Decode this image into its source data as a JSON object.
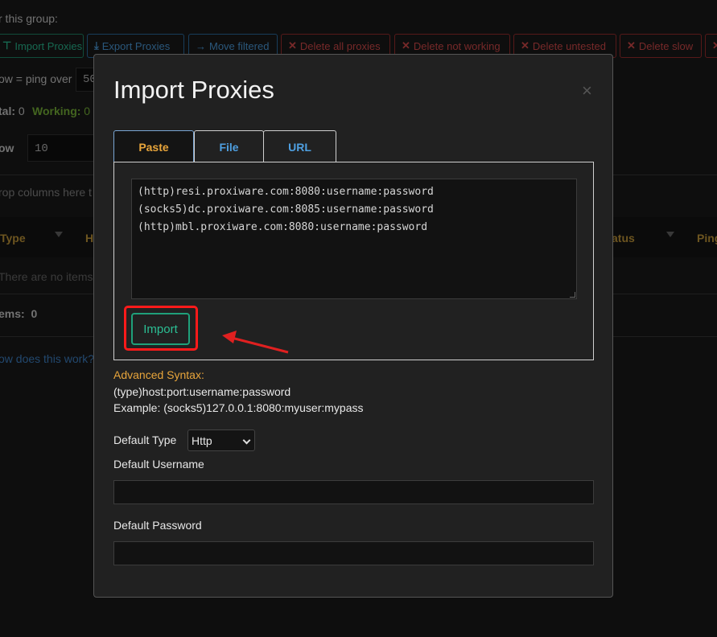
{
  "background": {
    "group_label": "r this group:",
    "toolbar": [
      {
        "label": "Import Proxies",
        "icon": "filter-icon",
        "style": "green"
      },
      {
        "label": "Export Proxies",
        "icon": "download-icon",
        "style": "blue"
      },
      {
        "label": "Move filtered",
        "icon": "arrow-right-icon",
        "style": "blue"
      },
      {
        "label": "Delete all proxies",
        "icon": "x-icon",
        "style": "red"
      },
      {
        "label": "Delete not working",
        "icon": "x-icon",
        "style": "red"
      },
      {
        "label": "Delete untested",
        "icon": "x-icon",
        "style": "red"
      },
      {
        "label": "Delete slow",
        "icon": "x-icon",
        "style": "red"
      }
    ],
    "slow_label": "ow = ping over",
    "slow_value": "50",
    "total_label": "tal:",
    "total_value": "0",
    "working_label": "Working:",
    "working_value": "0",
    "show_label": "ow",
    "show_value": "10",
    "drop_hint": "rop columns here t",
    "columns": {
      "type": "Type",
      "h": "H",
      "status": "atus",
      "ping": "Ping"
    },
    "empty_message": "There are no items",
    "items_label": "ems:",
    "items_value": "0",
    "help_link": "ow does this work?"
  },
  "modal": {
    "title": "Import Proxies",
    "close": "×",
    "tabs": [
      {
        "label": "Paste",
        "active": true
      },
      {
        "label": "File",
        "active": false
      },
      {
        "label": "URL",
        "active": false
      }
    ],
    "textarea_value": "(http)resi.proxiware.com:8080:username:password\n(socks5)dc.proxiware.com:8085:username:password\n(http)mbl.proxiware.com:8080:username:password",
    "import_button": "Import",
    "advanced_title": "Advanced Syntax:",
    "syntax_line": "(type)host:port:username:password",
    "example_line": "Example: (socks5)127.0.0.1:8080:myuser:mypass",
    "default_type_label": "Default Type",
    "default_type_value": "Http",
    "default_username_label": "Default Username",
    "default_username_value": "",
    "default_password_label": "Default Password",
    "default_password_value": "",
    "password_manager_icon": "password-manager-icon"
  },
  "annotation": {
    "highlight_color": "#ff1a1a",
    "arrow_color": "#e02020"
  }
}
